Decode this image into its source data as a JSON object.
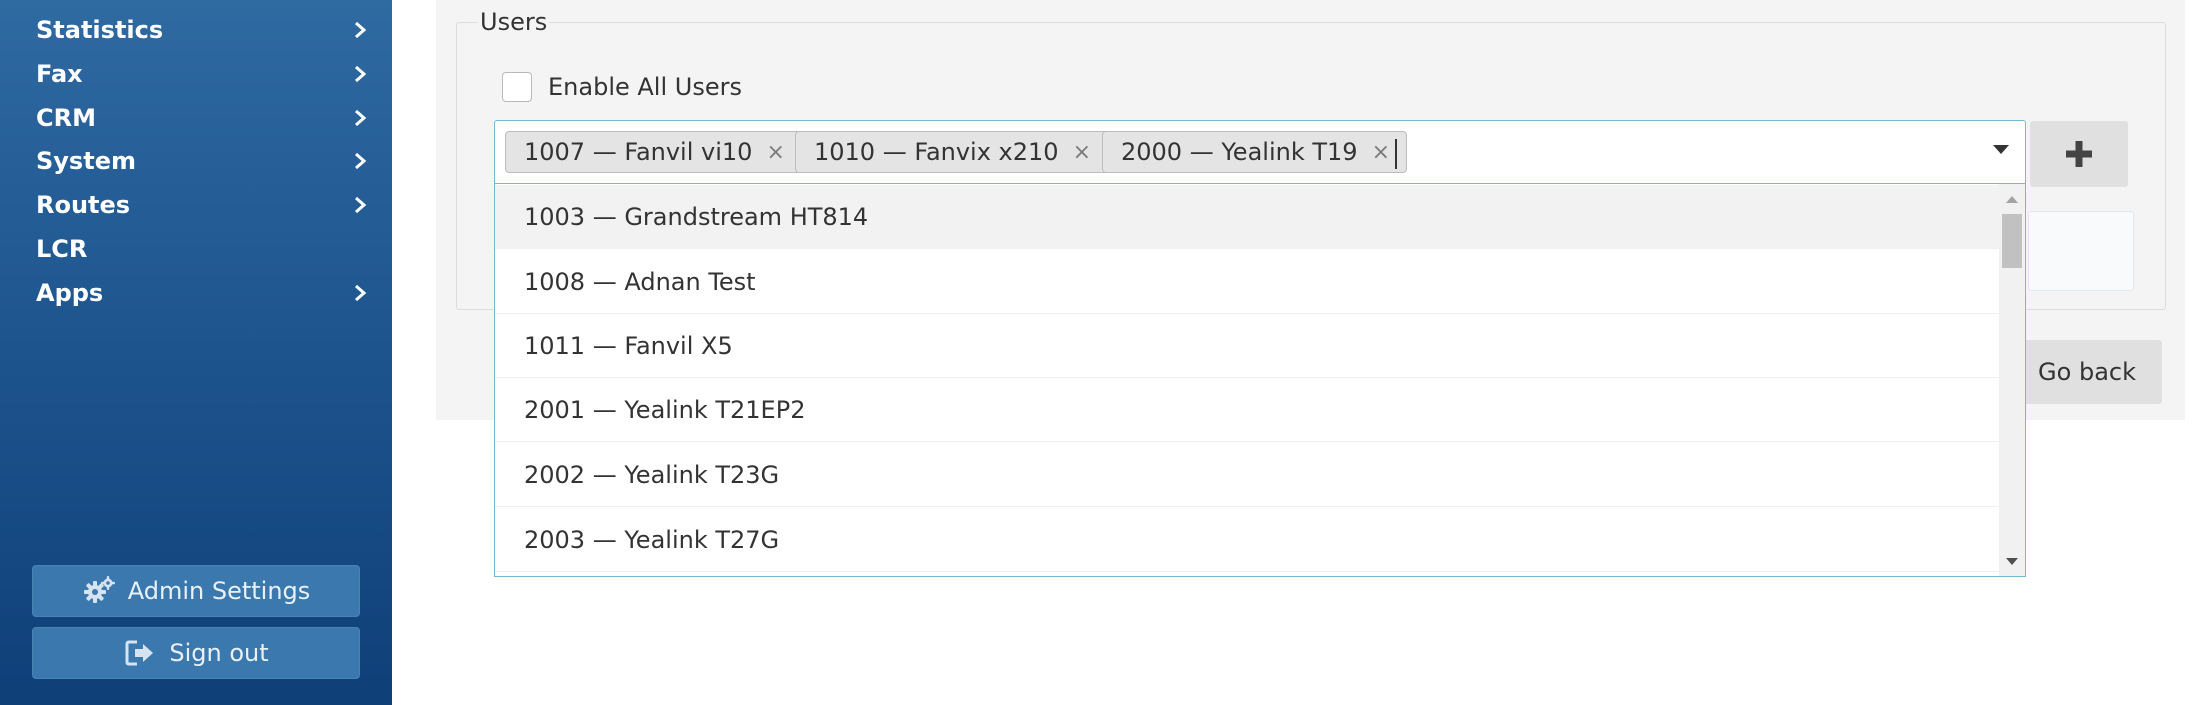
{
  "sidebar": {
    "items": [
      {
        "label": "Statistics",
        "has_chevron": true
      },
      {
        "label": "Fax",
        "has_chevron": true
      },
      {
        "label": "CRM",
        "has_chevron": true
      },
      {
        "label": "System",
        "has_chevron": true
      },
      {
        "label": "Routes",
        "has_chevron": true
      },
      {
        "label": "LCR",
        "has_chevron": false
      },
      {
        "label": "Apps",
        "has_chevron": true
      }
    ],
    "admin_settings_label": "Admin Settings",
    "admin_settings_icon": "gears-icon",
    "sign_out_label": "Sign out",
    "sign_out_icon": "sign-out-icon"
  },
  "users": {
    "legend": "Users",
    "enable_all_label": "Enable All Users",
    "enable_all_checked": false,
    "selected_tags": [
      {
        "text": "1007 — Fanvil vi10",
        "remove": "×"
      },
      {
        "text": "1010 — Fanvix x210",
        "remove": "×"
      },
      {
        "text": "2000 — Yealink T19",
        "remove": "×"
      }
    ],
    "options": [
      {
        "text": "1003 — Grandstream HT814",
        "highlighted": true
      },
      {
        "text": "1008 — Adnan Test",
        "highlighted": false
      },
      {
        "text": "1011 — Fanvil X5",
        "highlighted": false
      },
      {
        "text": "2001 — Yealink T21EP2",
        "highlighted": false
      },
      {
        "text": "2002 — Yealink T23G",
        "highlighted": false
      },
      {
        "text": "2003 — Yealink T27G",
        "highlighted": false
      }
    ],
    "add_button_icon": "plus-icon",
    "go_back_label": "Go back"
  },
  "colors": {
    "sidebar_top": "#2f6aa1",
    "sidebar_bottom": "#0f3f77",
    "focus_border": "#7ab8d2"
  }
}
